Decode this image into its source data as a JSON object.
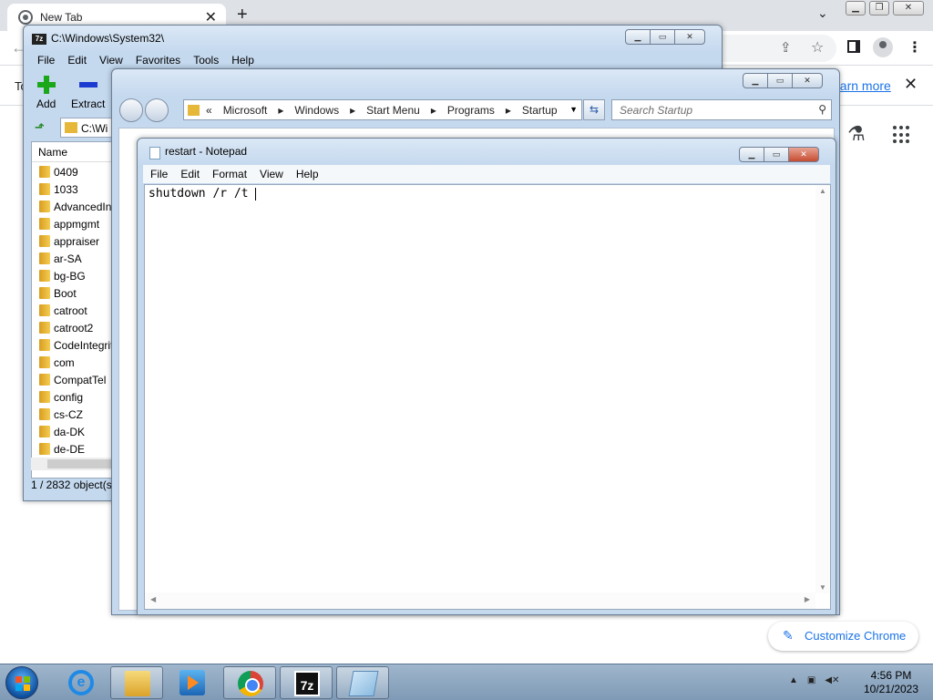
{
  "chrome": {
    "tab_title": "New Tab",
    "infobar_text": "To",
    "learn_more": "earn more",
    "customize_label": "Customize Chrome"
  },
  "sevenzip": {
    "title": "C:\\Windows\\System32\\",
    "menu": [
      "File",
      "Edit",
      "View",
      "Favorites",
      "Tools",
      "Help"
    ],
    "toolbar": {
      "add": "Add",
      "extract": "Extract"
    },
    "path": "C:\\Wi",
    "column_name": "Name",
    "files": [
      "0409",
      "1033",
      "AdvancedIns",
      "appmgmt",
      "appraiser",
      "ar-SA",
      "bg-BG",
      "Boot",
      "catroot",
      "catroot2",
      "CodeIntegrit",
      "com",
      "CompatTel",
      "config",
      "cs-CZ",
      "da-DK",
      "de-DE"
    ],
    "status": "1 / 2832 object(s"
  },
  "explorer": {
    "breadcrumb": [
      "«",
      "Microsoft",
      "▸",
      "Windows",
      "▸",
      "Start Menu",
      "▸",
      "Programs",
      "▸",
      "Startup"
    ],
    "search_placeholder": "Search Startup"
  },
  "notepad": {
    "title": "restart - Notepad",
    "menu": [
      "File",
      "Edit",
      "Format",
      "View",
      "Help"
    ],
    "content": "shutdown /r /t "
  },
  "taskbar": {
    "time": "4:56 PM",
    "date": "10/21/2023"
  },
  "colors": {
    "accent": "#1a73e8",
    "titlebar": "#c4d8ee",
    "taskbar": "#8fa8c1"
  }
}
